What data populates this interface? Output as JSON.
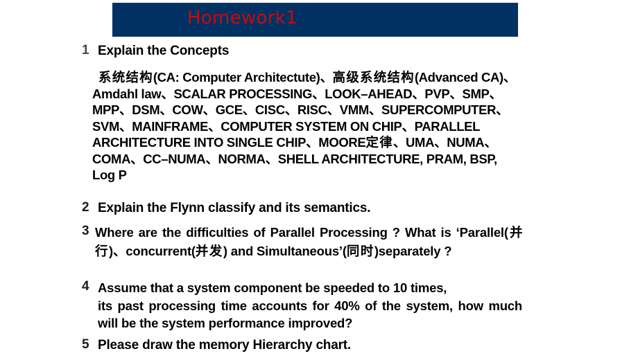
{
  "slide": {
    "title": "Homework1",
    "title_color": "#c20d12",
    "banner_color": "#023263",
    "background": "#ffffff"
  },
  "items": [
    {
      "number": "1",
      "heading": "Explain the Concepts",
      "terms_lines": [
        "系统结构",
        "(CA: Computer Architectute)、",
        "高级系统结构",
        "(Advanced CA)、Amdahl law、SCALAR PROCESSING、LOOK–AHEAD、PVP、SMP、MPP、DSM、COW、GCE、CISC、RISC、VMM、SUPERCOMPUTER、SVM、MAINFRAME、COMPUTER SYSTEM ON CHIP、PARALLEL ARCHITECTURE INTO SINGLE CHIP、MOORE",
        "定律",
        "、UMA、NUMA、COMA、CC–NUMA、NORMA、SHELL ARCHITECTURE, PRAM, BSP, Log P"
      ]
    },
    {
      "number": "2",
      "heading": "Explain the Flynn classify and its semantics."
    },
    {
      "number": "3",
      "text_a": "Where are the difficulties of Parallel Processing ? What is ‘Parallel(",
      "text_cjk_1": "并行",
      "text_b": ")、concurrent(",
      "text_cjk_2": "并发",
      "text_c": ") and Simultaneous’(",
      "text_cjk_3": "同时",
      "text_d": ")separately ?"
    },
    {
      "number": "4",
      "line1": "Assume that a system component be  speeded  to 10 times,",
      "line2": "its past processing time accounts for 40% of the system, how much will be the system performance improved?"
    },
    {
      "number": "5",
      "heading": "Please draw the memory Hierarchy chart."
    }
  ]
}
